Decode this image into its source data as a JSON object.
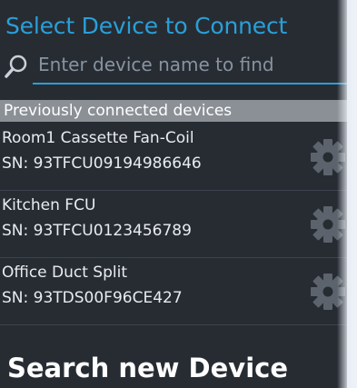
{
  "header": {
    "title": "Select Device to Connect"
  },
  "search": {
    "placeholder": "Enter device name to find",
    "icon": "search-icon"
  },
  "section": {
    "label": "Previously connected devices"
  },
  "devices": [
    {
      "name": "Room1 Cassette Fan-Coil",
      "sn": "SN: 93TFCU09194986646",
      "icon": "gear-icon"
    },
    {
      "name": "Kitchen FCU",
      "sn": "SN: 93TFCU0123456789",
      "icon": "gear-icon"
    },
    {
      "name": "Office Duct Split",
      "sn": "SN: 93TDS00F96CE427",
      "icon": "gear-icon"
    }
  ],
  "actions": {
    "search_new_label": "Search new Device"
  },
  "colors": {
    "accent": "#2a9fd8",
    "background": "#272c33",
    "section_header": "#8b9096"
  }
}
